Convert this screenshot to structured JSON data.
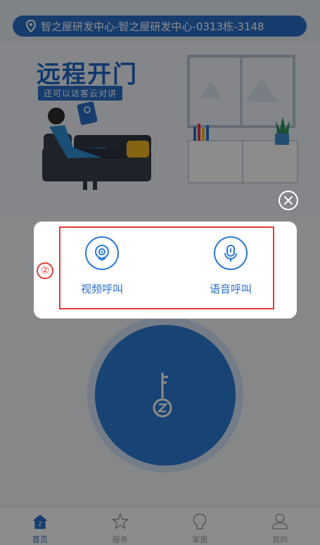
{
  "location": {
    "text": "智之屋研发中心-智之屋研发中心-0313栋-3148",
    "icon": "location-pin-icon"
  },
  "hero": {
    "title": "远程开门",
    "subtitle": "还可以访客云对讲"
  },
  "popup": {
    "marker": "②",
    "options": [
      {
        "label": "视频呼叫",
        "icon": "camera-icon"
      },
      {
        "label": "语音呼叫",
        "icon": "microphone-icon"
      }
    ],
    "close_icon": "close-icon"
  },
  "key_button": {
    "icon": "key-icon"
  },
  "tabbar": {
    "tabs": [
      {
        "label": "首页",
        "icon": "home-icon",
        "active": true
      },
      {
        "label": "服务",
        "icon": "star-icon",
        "active": false
      },
      {
        "label": "家居",
        "icon": "bulb-icon",
        "active": false
      },
      {
        "label": "我的",
        "icon": "user-icon",
        "active": false
      }
    ]
  },
  "colors": {
    "primary": "#2b6fc9",
    "annotation": "#e53935",
    "overlay": "rgba(0,0,0,0.45)"
  }
}
